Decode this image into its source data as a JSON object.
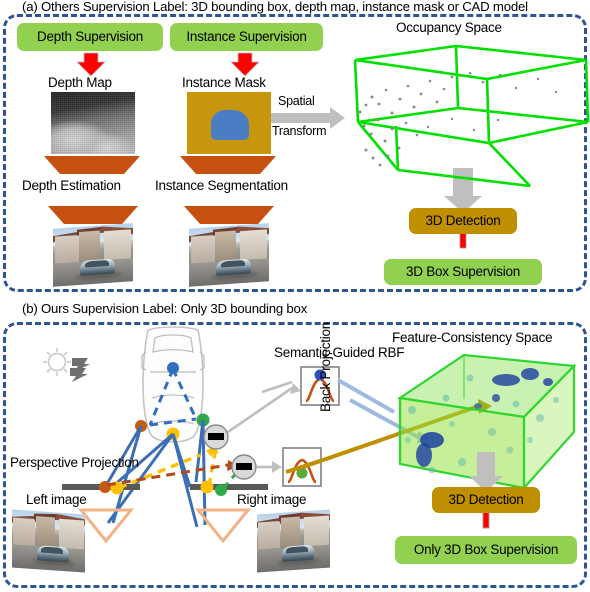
{
  "figure": {
    "panel_a": {
      "caption": "(a) Others Supervision Label: 3D bounding box, depth map, instance mask or CAD model",
      "chips": [
        {
          "id": "depth-supervision",
          "label": "Depth Supervision",
          "color": "#92d050"
        },
        {
          "id": "instance-supervision",
          "label": "Instance Supervision",
          "color": "#92d050"
        },
        {
          "id": "3d-detection-a",
          "label": "3D Detection",
          "color": "#bf8f00"
        },
        {
          "id": "3d-box-supervision",
          "label": "3D Box Supervision",
          "color": "#92d050"
        }
      ],
      "labels": {
        "depth_map": "Depth Map",
        "instance_mask": "Instance Mask",
        "depth_estimation": "Depth Estimation",
        "instance_segmentation": "Instance Segmentation",
        "occupancy_space": "Occupancy Space",
        "spatial": "Spatial",
        "transform": "Transform"
      }
    },
    "panel_b": {
      "caption": "(b) Ours Supervision Label: Only 3D bounding box",
      "chips": [
        {
          "id": "3d-detection-b",
          "label": "3D Detection",
          "color": "#bf8f00"
        },
        {
          "id": "only-3d-box-supervision",
          "label": "Only 3D Box Supervision",
          "color": "#92d050"
        }
      ],
      "labels": {
        "semantic_guided_rbf": "Semantic-Guided RBF",
        "feature_consistency_space": "Feature-Consistency Space",
        "back_projection": "Back Projection",
        "perspective_projection": "Perspective Projection",
        "left_image": "Left image",
        "right_image": "Right image"
      }
    },
    "colors": {
      "panel_border": "#2e5496",
      "green_chip": "#92d050",
      "gold_chip": "#bf8f00",
      "red_arrow": "#ff0000",
      "orange_trapezoid": "#c5500f",
      "gray_arrow": "#bfbfbf",
      "wire_green": "#00e000",
      "dot_blue": "#2e6fc0",
      "dot_orange": "#c55a11",
      "dot_yellow": "#ffc000",
      "dot_green": "#2eaa4a",
      "mask_bg": "#c8960c",
      "mask_blob": "#4a7ec4",
      "rbf_curve": "#c5500f",
      "ray_blue": "#3b6fb5",
      "ray_gold": "#bf8f00"
    }
  }
}
